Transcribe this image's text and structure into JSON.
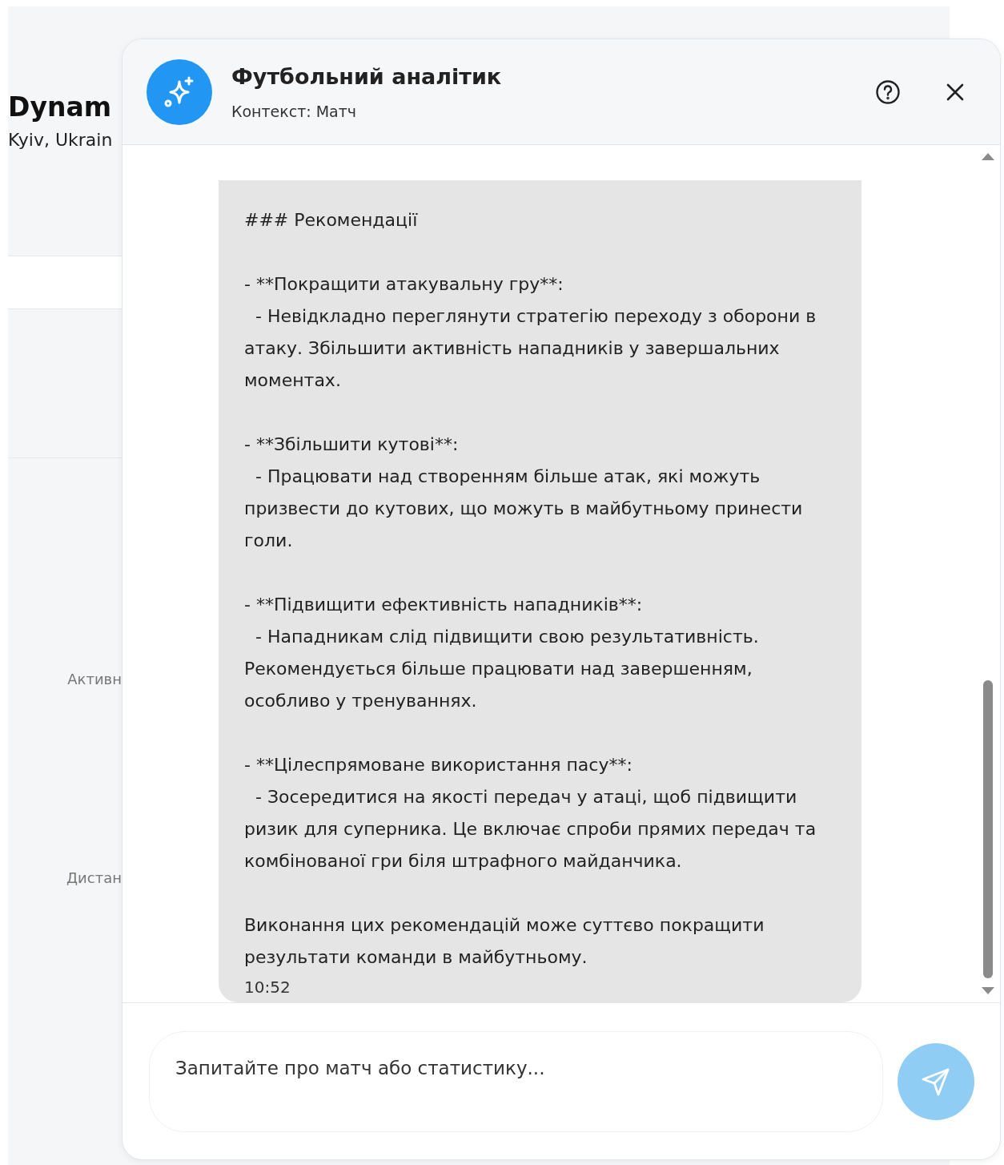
{
  "background_page": {
    "team_name": "Dynam",
    "location": "Kyiv, Ukrain",
    "stat_labels": [
      "Активн",
      "Дистан"
    ]
  },
  "chat": {
    "title": "Футбольний аналітик",
    "context": "Контекст: Матч",
    "messages": [
      {
        "text": "### Рекомендації\n\n- **Покращити атакувальну гру**:\n  - Невідкладно переглянути стратегію переходу з оборони в атаку. Збільшити активність нападників у завершальних моментах.\n\n- **Збільшити кутові**:\n  - Працювати над створенням більше атак, які можуть призвести до кутових, що можуть в майбутньому принести голи.\n\n- **Підвищити ефективність нападників**:\n  - Нападникам слід підвищити свою результативність. Рекомендується більше працювати над завершенням, особливо у тренуваннях.\n\n- **Цілеспрямоване використання пасу**:\n  - Зосередитися на якості передач у атаці, щоб підвищити ризик для суперника. Це включає спроби прямих передач та комбінованої гри біля штрафного майданчика.\n\nВиконання цих рекомендацій може суттєво покращити результати команди в майбутньому.",
        "time": "10:52"
      }
    ],
    "input": {
      "placeholder": "Запитайте про матч або статистику..."
    },
    "send_button": {
      "disabled": true
    }
  }
}
